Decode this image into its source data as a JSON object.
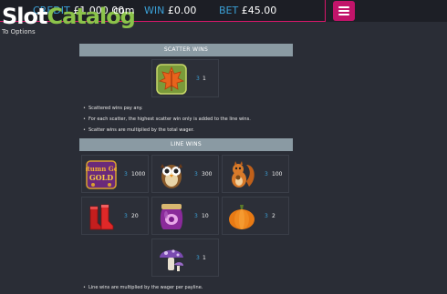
{
  "topbar": {
    "credit_label": "CREDIT",
    "credit_value": "£1,000.00",
    "win_label": "WIN",
    "win_value": "£0.00",
    "bet_label": "BET",
    "bet_value": "£45.00",
    "menu_icon": "hamburger-menu-icon"
  },
  "watermark": {
    "slot": "Slot",
    "catalog": "Catalog",
    "com_suffix": "com"
  },
  "nav": {
    "to_options": "To Options"
  },
  "scatter": {
    "header": "SCATTER WINS",
    "tiles": [
      {
        "symbol": "leaf-icon",
        "count": "3",
        "payout": "1"
      }
    ],
    "notes": [
      "Scattered wins pay any.",
      "For each scatter, the highest scatter win only is added to the line wins.",
      "Scatter wins are multiplied by the total wager."
    ]
  },
  "line": {
    "header": "LINE WINS",
    "logo_text": "Autumn Gold",
    "tiles": [
      {
        "symbol": "autumn-gold-logo-icon",
        "count": "3",
        "payout": "1000"
      },
      {
        "symbol": "owl-icon",
        "count": "3",
        "payout": "300"
      },
      {
        "symbol": "squirrel-icon",
        "count": "3",
        "payout": "100"
      },
      {
        "symbol": "boots-icon",
        "count": "3",
        "payout": "20"
      },
      {
        "symbol": "jam-jar-icon",
        "count": "3",
        "payout": "10"
      },
      {
        "symbol": "pumpkin-icon",
        "count": "3",
        "payout": "2"
      },
      {
        "symbol": "mushroom-icon",
        "count": "3",
        "payout": "1"
      }
    ],
    "notes": [
      "Line wins are multiplied by the wager per payline."
    ]
  },
  "colors": {
    "background": "#2a2d36",
    "accent_pink": "#c2146a",
    "label_blue": "#3ba0d6",
    "header_gray": "#8a9aa3",
    "logo_green": "#8bc34a"
  }
}
